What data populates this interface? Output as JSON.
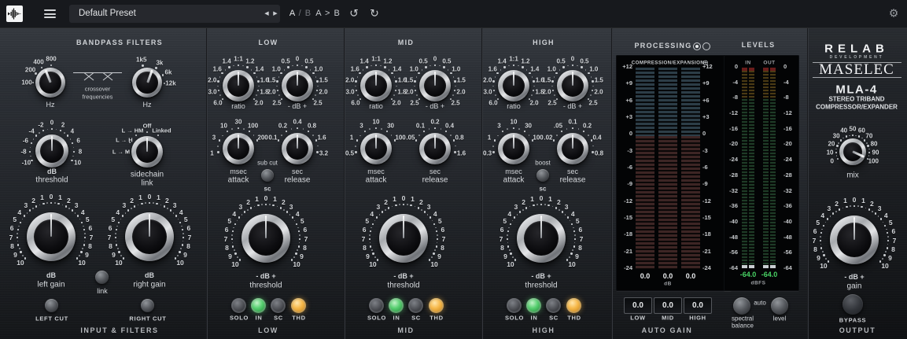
{
  "titlebar": {
    "preset": "Default Preset",
    "prev_icon": "◀",
    "next_icon": "▶",
    "ab_a": "A",
    "ab_rest": "/ B",
    "a_to_b": "A > B",
    "undo_icon": "↺",
    "redo_icon": "↻",
    "gear_icon": "⚙"
  },
  "captions": {
    "hz": "Hz",
    "db": "dB",
    "pm_db": "- dB +",
    "ratio": "ratio",
    "msec": "msec",
    "attack": "attack",
    "sec": "sec",
    "release": "release",
    "threshold": "threshold",
    "mix": "mix",
    "gain": "gain"
  },
  "input": {
    "title": "BANDPASS FILTERS",
    "crossover1": "crossover",
    "crossover2": "frequencies",
    "sidechain1": "sidechain",
    "sidechain2": "link",
    "left_gain": "left gain",
    "right_gain": "right gain",
    "link": "link",
    "left_cut": "LEFT CUT",
    "right_cut": "RIGHT CUT",
    "footer": "INPUT & FILTERS"
  },
  "low": {
    "title": "LOW",
    "sub_cut": "sub cut",
    "sc": "sc",
    "footer": "LOW"
  },
  "mid": {
    "title": "MID",
    "footer": "MID"
  },
  "high": {
    "title": "HIGH",
    "boost": "boost",
    "sc": "sc",
    "footer": "HIGH"
  },
  "leds": [
    "SOLO",
    "IN",
    "SC",
    "THD"
  ],
  "processing": {
    "title": "PROCESSING",
    "meter_title": "COMPRESSION/EXPANSION",
    "zoom_icon": "⊕",
    "scale": [
      "+12",
      "+9",
      "+6",
      "+3",
      "0",
      "-3",
      "-6",
      "-9",
      "-12",
      "-15",
      "-18",
      "-21",
      "-24"
    ],
    "readouts": [
      "0.0",
      "0.0",
      "0.0"
    ],
    "unit": "dB"
  },
  "levels": {
    "title": "LEVELS",
    "in": "IN",
    "out": "OUT",
    "scale": [
      "0",
      "-4",
      "-8",
      "-12",
      "-16",
      "-20",
      "-24",
      "-28",
      "-32",
      "-36",
      "-40",
      "-48",
      "-56",
      "-64"
    ],
    "readouts": [
      "-64.0",
      "-64.0"
    ],
    "unit": "dBFS"
  },
  "autogain": {
    "values": [
      "0.0",
      "0.0",
      "0.0"
    ],
    "labels": [
      "LOW",
      "MID",
      "HIGH"
    ],
    "title": "AUTO GAIN",
    "auto": "auto",
    "spectral1": "spectral",
    "spectral2": "balance",
    "level": "level"
  },
  "output": {
    "bypass": "BYPASS",
    "footer": "OUTPUT"
  },
  "branding": {
    "relab": "RELAB",
    "dev": "DEVELOPMENT",
    "maselec": "MASELEC",
    "model": "MLA-4",
    "sub1": "STEREO TRIBAND",
    "sub2": "COMPRESSOR/EXPANDER"
  },
  "colors": {
    "led_green": "#57cf70",
    "led_amber": "#f6b84a",
    "expansion_meter": "#2c3d47",
    "compression_meter": "#3d2524",
    "level_hot": "#4a3a14",
    "level_green": "#1e3b26",
    "readout_green": "#49d465"
  },
  "knob_defs": {
    "xover_lo": {
      "l": [
        [
          "100",
          -90
        ],
        [
          "200",
          -58
        ],
        [
          "400",
          -30
        ],
        [
          "800",
          2
        ]
      ],
      "p": -22
    },
    "xover_hi": {
      "l": [
        [
          "1k5",
          -14
        ],
        [
          "3k",
          32
        ],
        [
          "6k",
          64
        ],
        [
          "12k",
          92
        ]
      ],
      "p": 20
    },
    "thresh20": {
      "l": [
        [
          "0",
          0
        ],
        [
          "-2",
          -23
        ],
        [
          "2",
          23
        ],
        [
          "-4",
          -46
        ],
        [
          "4",
          46
        ],
        [
          "-6",
          -69
        ],
        [
          "6",
          69
        ],
        [
          "-8",
          -92
        ],
        [
          "8",
          92
        ],
        [
          "-10",
          -115
        ],
        [
          "10",
          115
        ]
      ],
      "d": [
        -115,
        115,
        11.5
      ],
      "p": 0
    },
    "sidechain": {
      "l": [
        [
          "Off",
          0
        ],
        [
          "Linked",
          34
        ],
        [
          "L → HM",
          -34
        ],
        [
          "L → H",
          -62
        ],
        [
          "L → M",
          -90
        ]
      ],
      "p": 0
    },
    "ratio": {
      "l": [
        [
          "1:1",
          0
        ],
        [
          "1.2",
          26
        ],
        [
          "1.4",
          -26
        ],
        [
          "1.4",
          52
        ],
        [
          "1.6",
          -52
        ],
        [
          "1.6",
          78
        ],
        [
          "2.0",
          -78
        ],
        [
          "1.8",
          104
        ],
        [
          "3.0",
          -104
        ],
        [
          "2.0",
          130
        ],
        [
          "6.0",
          -130
        ]
      ],
      "d": [
        -130,
        130,
        13
      ],
      "p": 0
    },
    "banddb": {
      "l": [
        [
          "0",
          0
        ],
        [
          "0.5",
          -26
        ],
        [
          "0.5",
          26
        ],
        [
          "1.0",
          -52
        ],
        [
          "1.0",
          52
        ],
        [
          "1.5",
          -78
        ],
        [
          "1.5",
          78
        ],
        [
          "2.0",
          -104
        ],
        [
          "2.0",
          104
        ],
        [
          "2.5",
          -130
        ],
        [
          "2.5",
          130
        ]
      ],
      "d": [
        -130,
        130,
        13
      ],
      "p": 0
    },
    "atk_low": {
      "l": [
        [
          "30",
          0
        ],
        [
          "10",
          -33
        ],
        [
          "3",
          -66
        ],
        [
          "1",
          -100
        ],
        [
          "100",
          33
        ],
        [
          "200",
          66
        ]
      ],
      "d": [
        -100,
        66,
        16.5
      ],
      "p": 0
    },
    "atk_mid": {
      "l": [
        [
          "10",
          0
        ],
        [
          "3",
          -33
        ],
        [
          "1",
          -66
        ],
        [
          "0.5",
          -100
        ],
        [
          "30",
          33
        ],
        [
          "100",
          66
        ]
      ],
      "d": [
        -100,
        66,
        16.5
      ],
      "p": 0
    },
    "atk_high": {
      "l": [
        [
          "10",
          0
        ],
        [
          "3",
          -33
        ],
        [
          "1",
          -66
        ],
        [
          "0.3",
          -100
        ],
        [
          "30",
          33
        ],
        [
          "100",
          66
        ]
      ],
      "d": [
        -100,
        66,
        16.5
      ],
      "p": 0
    },
    "rel_low": {
      "l": [
        [
          "0.4",
          0
        ],
        [
          "0.2",
          -33
        ],
        [
          "0.1",
          -66
        ],
        [
          "0.8",
          33
        ],
        [
          "1.6",
          66
        ],
        [
          "3.2",
          100
        ]
      ],
      "d": [
        -66,
        100,
        16.5
      ],
      "p": 0
    },
    "rel_mid": {
      "l": [
        [
          "0.2",
          0
        ],
        [
          "0.1",
          -33
        ],
        [
          ".05",
          -66
        ],
        [
          "0.4",
          33
        ],
        [
          "0.8",
          66
        ],
        [
          "1.6",
          100
        ]
      ],
      "d": [
        -66,
        100,
        16.5
      ],
      "p": 0
    },
    "rel_high": {
      "l": [
        [
          "0.1",
          0
        ],
        [
          ".05",
          -33
        ],
        [
          ".02",
          -66
        ],
        [
          "0.2",
          33
        ],
        [
          "0.4",
          66
        ],
        [
          "0.8",
          100
        ]
      ],
      "d": [
        -66,
        100,
        16.5
      ],
      "p": 0
    },
    "db10": {
      "l": [
        [
          "0",
          0
        ],
        [
          "1",
          -13
        ],
        [
          "1",
          13
        ],
        [
          "2",
          -26
        ],
        [
          "2",
          26
        ],
        [
          "3",
          -39
        ],
        [
          "3",
          39
        ],
        [
          "4",
          -52
        ],
        [
          "4",
          52
        ],
        [
          "5",
          -65
        ],
        [
          "5",
          65
        ],
        [
          "6",
          -78
        ],
        [
          "6",
          78
        ],
        [
          "7",
          -91
        ],
        [
          "7",
          91
        ],
        [
          "8",
          -104
        ],
        [
          "8",
          104
        ],
        [
          "9",
          -117
        ],
        [
          "9",
          117
        ],
        [
          "10",
          -130
        ],
        [
          "10",
          130
        ]
      ],
      "d": [
        -130,
        130,
        6.5
      ],
      "p": 0
    },
    "mix": {
      "l": [
        [
          "0",
          -115
        ],
        [
          "10",
          -92
        ],
        [
          "20",
          -69
        ],
        [
          "30",
          -46
        ],
        [
          "40",
          -23
        ],
        [
          "50",
          0
        ],
        [
          "60",
          23
        ],
        [
          "70",
          46
        ],
        [
          "80",
          69
        ],
        [
          "90",
          92
        ],
        [
          "100",
          115
        ]
      ],
      "d": [
        -115,
        115,
        11.5
      ],
      "p": 115
    }
  }
}
